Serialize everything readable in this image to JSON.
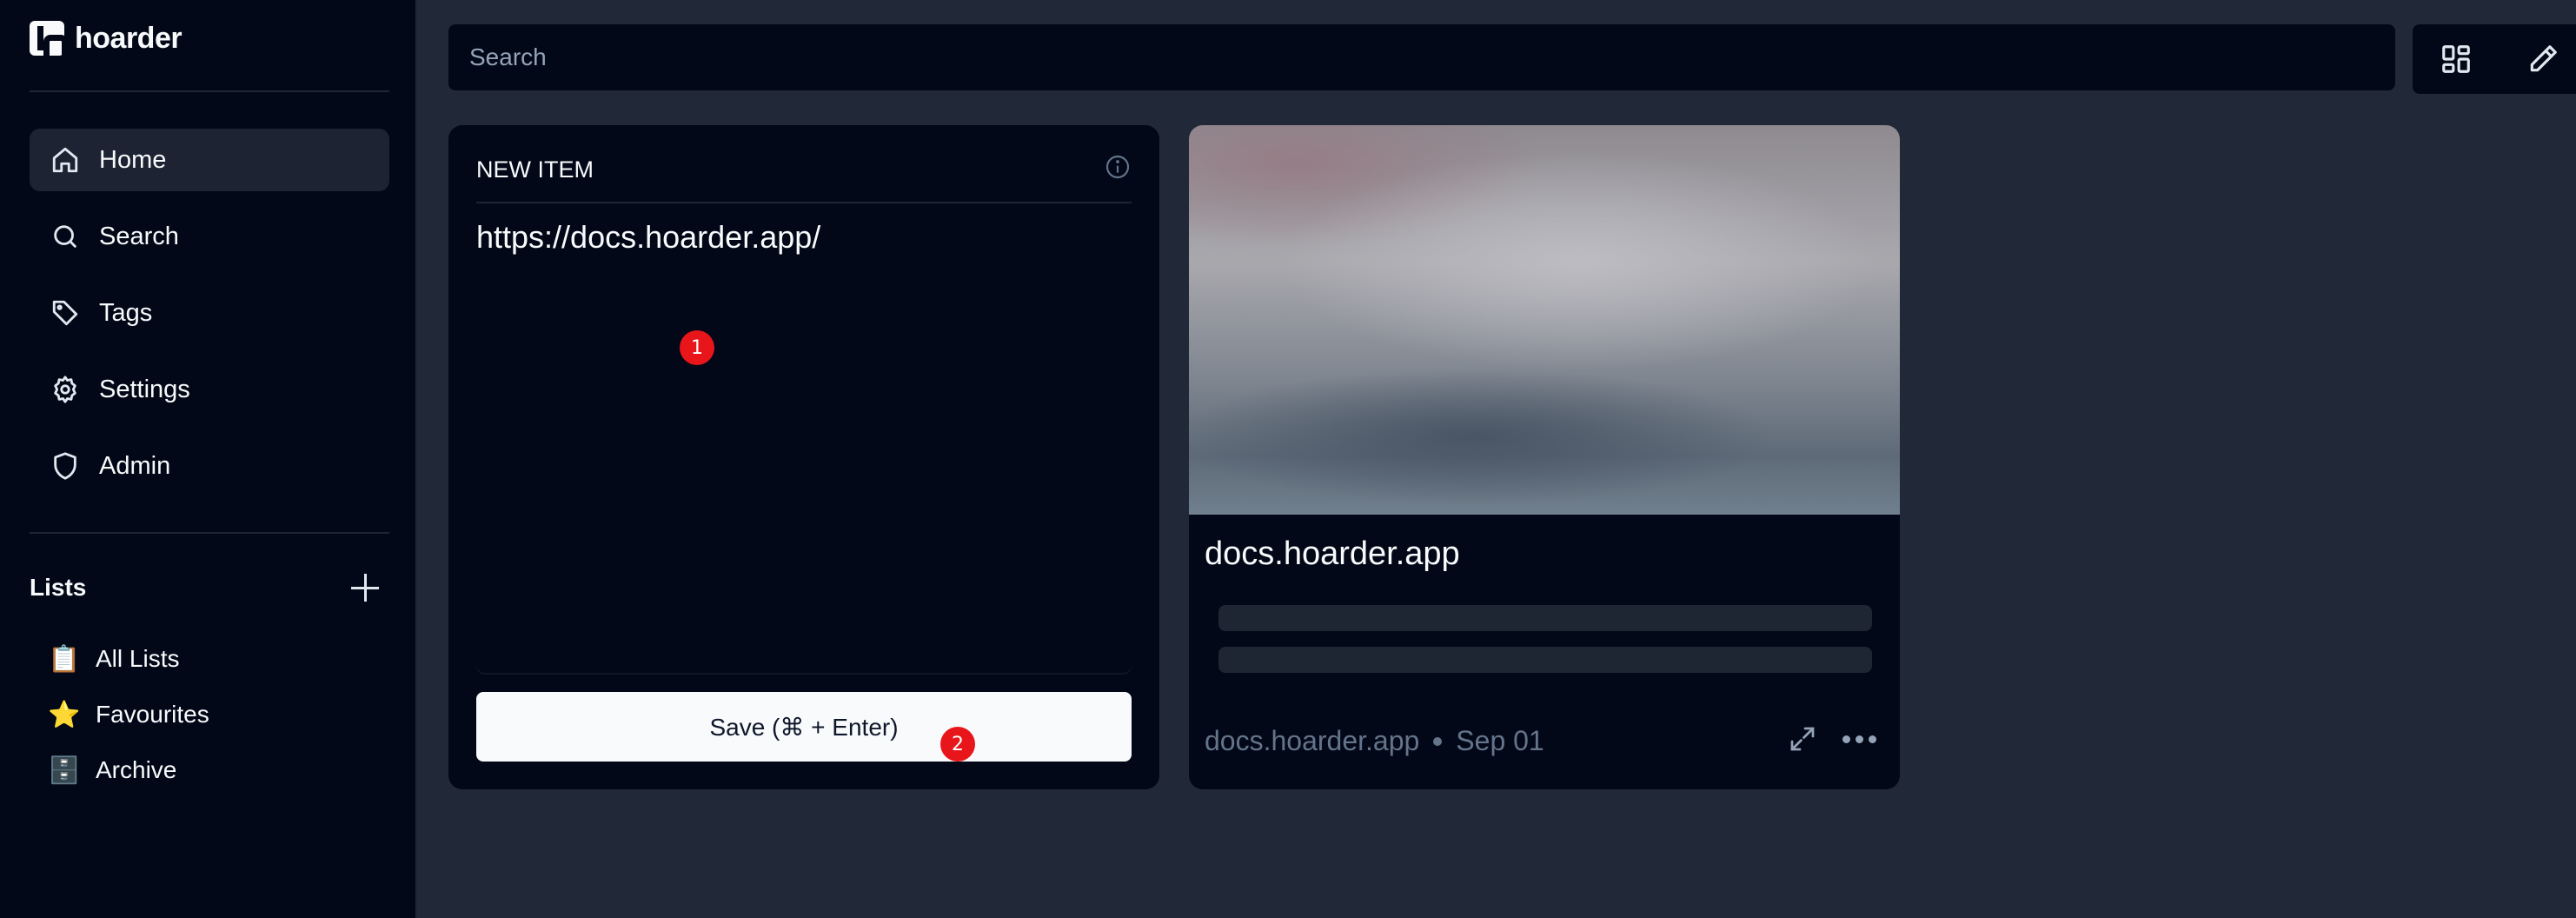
{
  "app": {
    "name": "hoarder"
  },
  "sidebar": {
    "nav": [
      {
        "label": "Home",
        "icon": "home-icon",
        "active": true
      },
      {
        "label": "Search",
        "icon": "search-icon"
      },
      {
        "label": "Tags",
        "icon": "tag-icon"
      },
      {
        "label": "Settings",
        "icon": "gear-icon"
      },
      {
        "label": "Admin",
        "icon": "shield-icon"
      }
    ],
    "lists_title": "Lists",
    "lists": [
      {
        "label": "All Lists",
        "emoji": "📋"
      },
      {
        "label": "Favourites",
        "emoji": "⭐"
      },
      {
        "label": "Archive",
        "emoji": "🗄️"
      }
    ]
  },
  "topbar": {
    "search_placeholder": "Search"
  },
  "new_item": {
    "title": "NEW ITEM",
    "input_value": "https://docs.hoarder.app/",
    "save_label": "Save (⌘ + Enter)"
  },
  "bookmark": {
    "title": "docs.hoarder.app",
    "domain": "docs.hoarder.app",
    "date": "Sep 01"
  },
  "markers": [
    "1",
    "2"
  ],
  "colors": {
    "sidebar_bg": "#020817",
    "page_bg": "#212838",
    "card_bg": "#020817",
    "marker": "#e8161b"
  }
}
